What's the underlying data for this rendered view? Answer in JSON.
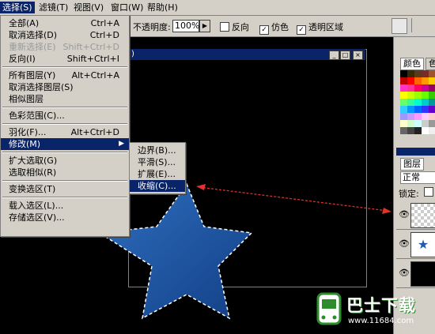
{
  "menubar": {
    "items": [
      {
        "label": "选择(S)",
        "active": true
      },
      {
        "label": "滤镜(T)"
      },
      {
        "label": "视图(V)"
      },
      {
        "label": "窗口(W)"
      },
      {
        "label": "帮助(H)"
      }
    ]
  },
  "options": {
    "opacity_label": "不透明度:",
    "opacity_value": "100%",
    "reverse": "反向",
    "dither": "仿色",
    "transparency": "透明区域"
  },
  "select_menu": {
    "items": [
      {
        "label": "全部(A)",
        "shortcut": "Ctrl+A"
      },
      {
        "label": "取消选择(D)",
        "shortcut": "Ctrl+D"
      },
      {
        "label": "重新选择(E)",
        "shortcut": "Shift+Ctrl+D",
        "disabled": true
      },
      {
        "label": "反向(I)",
        "shortcut": "Shift+Ctrl+I"
      },
      {
        "label": "所有图层(Y)",
        "shortcut": "Alt+Ctrl+A"
      },
      {
        "label": "取消选择图层(S)"
      },
      {
        "label": "相似图层"
      },
      {
        "label": "色彩范围(C)..."
      },
      {
        "label": "羽化(F)...",
        "shortcut": "Alt+Ctrl+D"
      },
      {
        "label": "修改(M)"
      },
      {
        "label": "扩大选取(G)"
      },
      {
        "label": "选取相似(R)"
      },
      {
        "label": "变换选区(T)"
      },
      {
        "label": "载入选区(L)..."
      },
      {
        "label": "存储选区(V)..."
      }
    ]
  },
  "modify_submenu": {
    "items": [
      {
        "label": "边界(B)..."
      },
      {
        "label": "平滑(S)..."
      },
      {
        "label": "扩展(E)..."
      },
      {
        "label": "收缩(C)..."
      }
    ]
  },
  "panels": {
    "color_tab": "颜色",
    "swatch_tab": "色",
    "layers_tab": "图层",
    "blend_mode": "正常",
    "lock_label": "锁定:"
  },
  "watermark": {
    "brand": "巴士下载",
    "url": "www.11684.com"
  },
  "colors": {
    "menu_highlight": "#0a246a",
    "star_fill": "#1d5aa8",
    "arrow": "#e0322a"
  }
}
